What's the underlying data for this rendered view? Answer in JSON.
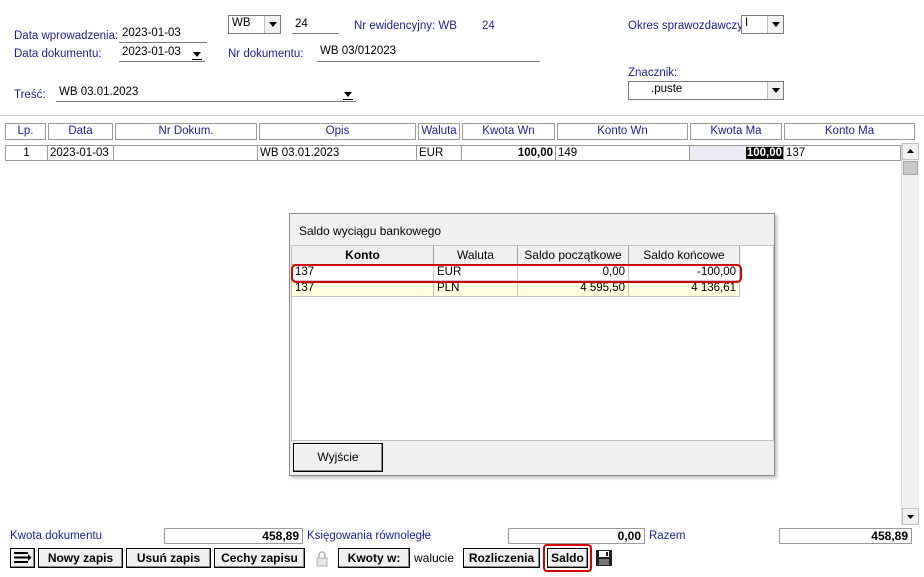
{
  "header": {
    "data_wprowadzenia_label": "Data wprowadzenia:",
    "data_wprowadzenia": "2023-01-03",
    "data_dokumentu_label": "Data dokumentu:",
    "data_dokumentu": "2023-01-03",
    "tresc_label": "Treść:",
    "tresc": "WB 03.01.2023",
    "rejestr": "WB",
    "numer": "24",
    "nr_ewidencyjny_label": "Nr ewidencyjny: WB",
    "nr_ewidencyjny": "24",
    "nr_dokumentu_label": "Nr dokumentu:",
    "nr_dokumentu": "WB 03/012023",
    "okres_label": "Okres sprawozdawczy:",
    "okres": "I",
    "znacznik_label": "Znacznik:",
    "znacznik": ".puste"
  },
  "table": {
    "columns": [
      "Lp.",
      "Data",
      "Nr Dokum.",
      "Opis",
      "Waluta",
      "Kwota Wn",
      "Konto Wn",
      "Kwota Ma",
      "Konto Ma"
    ],
    "rows": [
      {
        "lp": "1",
        "data": "2023-01-03",
        "nr": "",
        "opis": "WB 03.01.2023",
        "waluta": "EUR",
        "kwota_wn": "100,00",
        "konto_wn": "149",
        "kwota_ma": "100,00",
        "konto_ma": "137"
      }
    ]
  },
  "dialog": {
    "title": "Saldo wyciągu bankowego",
    "columns": [
      "Konto",
      "Waluta",
      "Saldo początkowe",
      "Saldo końcowe"
    ],
    "rows": [
      {
        "konto": "137",
        "waluta": "EUR",
        "saldo_pocz": "0,00",
        "saldo_konc": "-100,00"
      },
      {
        "konto": "137",
        "waluta": "PLN",
        "saldo_pocz": "4 595,50",
        "saldo_konc": "4 136,61"
      }
    ],
    "exit_button": "Wyjście"
  },
  "summary": {
    "kwota_dokumentu_label": "Kwota dokumentu",
    "kwota_dokumentu": "458,89",
    "ksiegowania_label": "Księgowania równoległe",
    "ksiegowania": "0,00",
    "razem_label": "Razem",
    "razem": "458,89"
  },
  "toolbar": {
    "nowy_zapis": "Nowy zapis",
    "usun_zapis": "Usuń zapis",
    "cechy_zapisu": "Cechy zapisu",
    "kwoty_w": "Kwoty w:",
    "walucie": "walucie",
    "rozliczenia": "Rozliczenia",
    "saldo": "Saldo"
  },
  "colors": {
    "label_blue": "#1e1e8c",
    "highlight_red": "#d40000",
    "row_yellow": "#ffffe0"
  }
}
